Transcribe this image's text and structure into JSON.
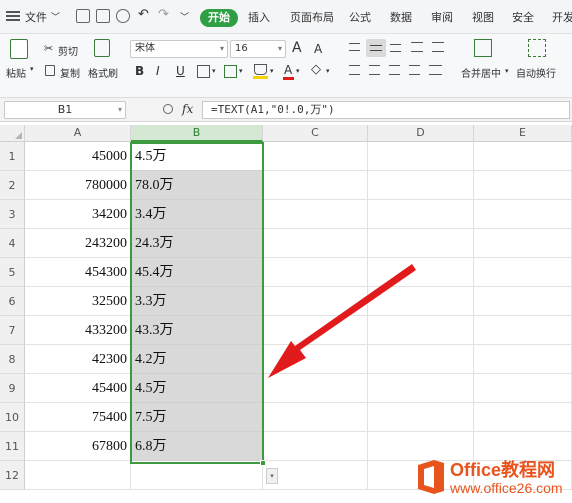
{
  "menu": {
    "file_label": "文件",
    "start_label": "开始",
    "tabs": [
      "插入",
      "页面布局",
      "公式",
      "数据",
      "审阅",
      "视图",
      "安全",
      "开发"
    ]
  },
  "ribbon": {
    "paste_label": "粘贴",
    "cut_label": "剪切",
    "copy_label": "复制",
    "format_painter_label": "格式刷",
    "font_name": "宋体",
    "font_size": "16",
    "grow_label": "A",
    "shrink_label": "A",
    "bold_label": "B",
    "italic_label": "I",
    "underline_label": "U",
    "font_color_label": "A",
    "merge_label": "合并居中",
    "wrap_label": "自动换行"
  },
  "formula_bar": {
    "cell_ref": "B1",
    "fx_label": "fx",
    "formula": "=TEXT(A1,\"0!.0,万\")"
  },
  "columns": [
    "A",
    "B",
    "C",
    "D",
    "E"
  ],
  "rows": [
    {
      "num": "1",
      "a": "45000",
      "b": "4.5万"
    },
    {
      "num": "2",
      "a": "780000",
      "b": "78.0万"
    },
    {
      "num": "3",
      "a": "34200",
      "b": "3.4万"
    },
    {
      "num": "4",
      "a": "243200",
      "b": "24.3万"
    },
    {
      "num": "5",
      "a": "454300",
      "b": "45.4万"
    },
    {
      "num": "6",
      "a": "32500",
      "b": "3.3万"
    },
    {
      "num": "7",
      "a": "433200",
      "b": "43.3万"
    },
    {
      "num": "8",
      "a": "42300",
      "b": "4.2万"
    },
    {
      "num": "9",
      "a": "45400",
      "b": "4.5万"
    },
    {
      "num": "10",
      "a": "75400",
      "b": "7.5万"
    },
    {
      "num": "11",
      "a": "67800",
      "b": "6.8万"
    },
    {
      "num": "12",
      "a": "",
      "b": ""
    }
  ],
  "watermark": {
    "brand": "Office教程网",
    "url": "www.office26.com",
    "brand_color": "#e8541e"
  },
  "colors": {
    "accent_green": "#2f9e44",
    "selection_border": "#3d9a3f",
    "arrow_red": "#e11b1b"
  }
}
